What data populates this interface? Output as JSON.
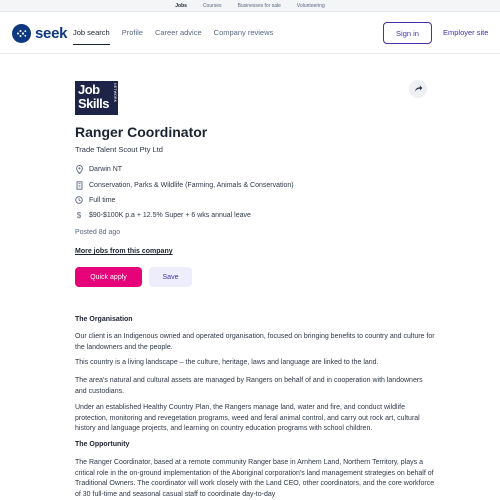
{
  "top_links": [
    "Jobs",
    "Courses",
    "Businesses for sale",
    "Volunteering"
  ],
  "header": {
    "logo_text": "seek",
    "nav": [
      "Job search",
      "Profile",
      "Career advice",
      "Company reviews"
    ],
    "sign_in": "Sign in",
    "employer_site": "Employer site"
  },
  "company_logo": {
    "line1": "Job",
    "line2": "Skills",
    "line3": "NETWORK"
  },
  "job": {
    "title": "Ranger Coordinator",
    "advertiser": "Trade Talent Scout Pty Ltd",
    "location": "Darwin NT",
    "classification": "Conservation, Parks & Wildlife (Farming, Animals & Conservation)",
    "work_type": "Full time",
    "salary": "$90-$100K p.a + 12.5% Super + 6 wks annual leave",
    "posted": "Posted 8d ago",
    "more_jobs": "More jobs from this company",
    "apply_label": "Quick apply",
    "save_label": "Save"
  },
  "description": {
    "heading1": "The Organisation",
    "p1": "Our client is an Indigenous owned and operated organisation, focused on bringing benefits to country and culture for the landowners and the people.",
    "p2": "This country is a living landscape – the culture, heritage, laws and language are linked to the land.",
    "p3": "The area's natural and cultural assets are managed by Rangers on behalf of and in cooperation with landowners and custodians.",
    "p4": "Under an established Healthy Country Plan, the Rangers manage land, water and fire, and conduct wildlife protection, monitoring and revegetation programs, weed and feral animal control, and carry out rock art, cultural history and language projects, and learning on country education programs with school children.",
    "heading2": "The Opportunity",
    "p5": "The Ranger Coordinator, based at a remote community Ranger base in Arnhem Land, Northern Territory, plays a critical role in the on-ground implementation of the Aboriginal corporation's land management strategies on behalf of Traditional Owners. The coordinator will work closely with the Land CEO, other coordinators, and the core workforce of 30 full-time and seasonal casual staff to coordinate day-to-day"
  },
  "colors": {
    "brand": "#0d3880",
    "accent": "#4331b0",
    "apply": "#e60278"
  }
}
